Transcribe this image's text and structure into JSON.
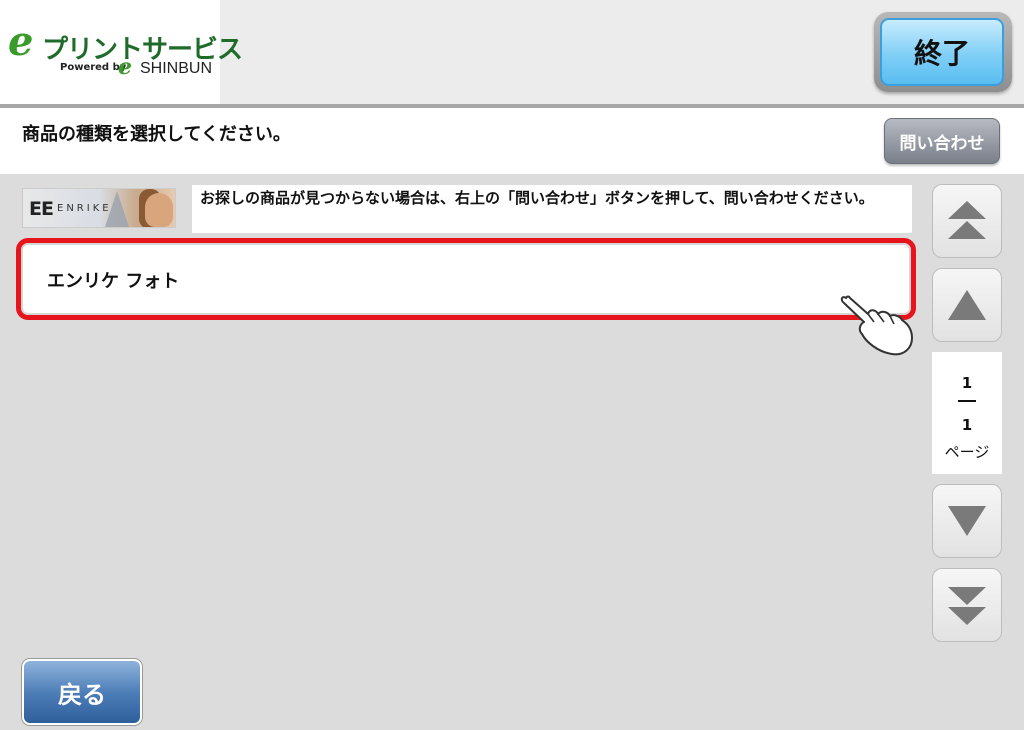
{
  "header": {
    "logo": {
      "e_mark": "e",
      "service_name": "プリントサービス",
      "powered_by": "Powered by",
      "e_mark_small": "e",
      "brand": "SHINBUN"
    },
    "end_button_label": "終了"
  },
  "instruction": {
    "text": "商品の種類を選択してください。",
    "contact_button_label": "問い合わせ"
  },
  "banner": {
    "logo_text": "EE",
    "logo_word": "ENRIKE",
    "info_text": "お探しの商品が見つからない場合は、右上の「問い合わせ」ボタンを押して、問い合わせください。"
  },
  "list": {
    "items": [
      {
        "label": "エンリケ フォト"
      }
    ]
  },
  "pagination": {
    "current": "1",
    "total": "1",
    "label": "ページ"
  },
  "footer": {
    "back_button_label": "戻る"
  },
  "colors": {
    "highlight_border": "#e8141c",
    "end_button": "#7fcff6",
    "back_button": "#4f7fb8",
    "logo_green": "#1f6b2a"
  },
  "icons": {
    "scroll_top": "double-up-arrow-icon",
    "scroll_up": "up-arrow-icon",
    "scroll_down": "down-arrow-icon",
    "scroll_bottom": "double-down-arrow-icon",
    "pointer": "pointing-hand-icon"
  }
}
